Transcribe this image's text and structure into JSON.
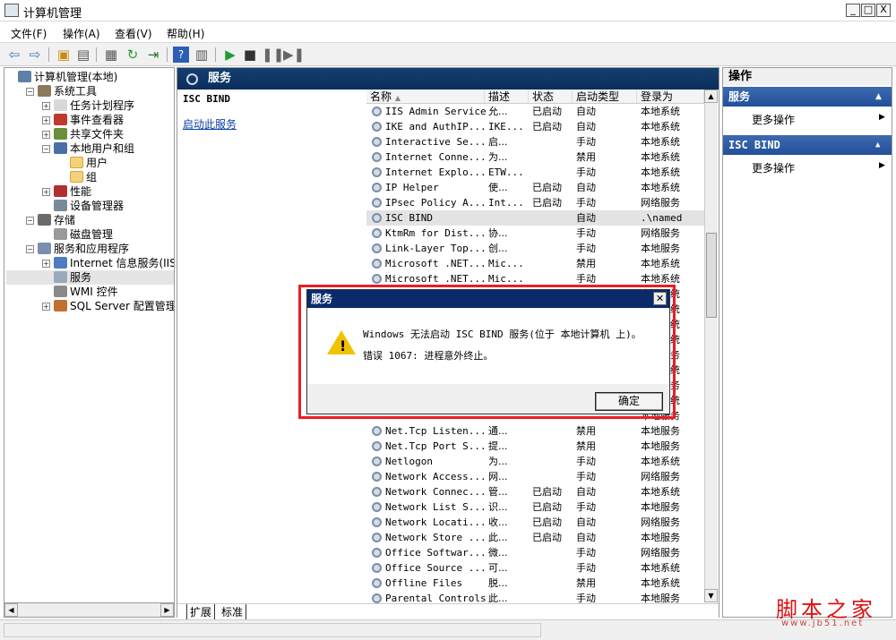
{
  "window": {
    "title": "计算机管理",
    "controls": [
      "_",
      "□",
      "X"
    ]
  },
  "menu": [
    "文件(F)",
    "操作(A)",
    "查看(V)",
    "帮助(H)"
  ],
  "toolbar": {
    "icons": [
      "back-icon",
      "forward-icon",
      "up-icon",
      "show-hide-tree-icon",
      "properties-icon",
      "refresh-icon",
      "export-icon",
      "help-icon",
      "view-icon",
      "play-icon",
      "stop-icon",
      "pause-icon",
      "resume-icon"
    ]
  },
  "tree": [
    {
      "label": "计算机管理(本地)",
      "depth": 0,
      "exp": "",
      "icon": "computer-icon"
    },
    {
      "label": "系统工具",
      "depth": 1,
      "exp": "−",
      "icon": "tools-icon"
    },
    {
      "label": "任务计划程序",
      "depth": 2,
      "exp": "+",
      "icon": "clock-icon"
    },
    {
      "label": "事件查看器",
      "depth": 2,
      "exp": "+",
      "icon": "event-icon"
    },
    {
      "label": "共享文件夹",
      "depth": 2,
      "exp": "+",
      "icon": "share-icon"
    },
    {
      "label": "本地用户和组",
      "depth": 2,
      "exp": "−",
      "icon": "users-icon"
    },
    {
      "label": "用户",
      "depth": 3,
      "exp": "",
      "icon": "folder-icon"
    },
    {
      "label": "组",
      "depth": 3,
      "exp": "",
      "icon": "folder-icon"
    },
    {
      "label": "性能",
      "depth": 2,
      "exp": "+",
      "icon": "performance-icon"
    },
    {
      "label": "设备管理器",
      "depth": 2,
      "exp": "",
      "icon": "device-icon"
    },
    {
      "label": "存储",
      "depth": 1,
      "exp": "−",
      "icon": "storage-icon"
    },
    {
      "label": "磁盘管理",
      "depth": 2,
      "exp": "",
      "icon": "disk-icon"
    },
    {
      "label": "服务和应用程序",
      "depth": 1,
      "exp": "−",
      "icon": "services-apps-icon"
    },
    {
      "label": "Internet 信息服务(IIS",
      "depth": 2,
      "exp": "+",
      "icon": "iis-icon"
    },
    {
      "label": "服务",
      "depth": 2,
      "exp": "",
      "icon": "gear-icon"
    },
    {
      "label": "WMI 控件",
      "depth": 2,
      "exp": "",
      "icon": "wmi-icon"
    },
    {
      "label": "SQL Server 配置管理器",
      "depth": 2,
      "exp": "+",
      "icon": "sql-icon"
    }
  ],
  "middle": {
    "header": "服务",
    "selected_service": "ISC BIND",
    "start_link_text": "启动此服务",
    "columns": [
      "名称",
      "描述",
      "状态",
      "启动类型",
      "登录为"
    ],
    "rows": [
      [
        "IIS Admin Service",
        "允...",
        "已启动",
        "自动",
        "本地系统"
      ],
      [
        "IKE and AuthIP...",
        "IKE...",
        "已启动",
        "自动",
        "本地系统"
      ],
      [
        "Interactive Se...",
        "启...",
        "",
        "手动",
        "本地系统"
      ],
      [
        "Internet Conne...",
        "为...",
        "",
        "禁用",
        "本地系统"
      ],
      [
        "Internet Explo...",
        "ETW...",
        "",
        "手动",
        "本地系统"
      ],
      [
        "IP Helper",
        "使...",
        "已启动",
        "自动",
        "本地系统"
      ],
      [
        "IPsec Policy A...",
        "Int...",
        "已启动",
        "手动",
        "网络服务"
      ],
      [
        "ISC BIND",
        "",
        "",
        "自动",
        ".\\named"
      ],
      [
        "KtmRm for Dist...",
        "协...",
        "",
        "手动",
        "网络服务"
      ],
      [
        "Link-Layer Top...",
        "创...",
        "",
        "手动",
        "本地服务"
      ],
      [
        "Microsoft .NET...",
        "Mic...",
        "",
        "禁用",
        "本地系统"
      ],
      [
        "Microsoft .NET...",
        "Mic...",
        "",
        "手动",
        "本地系统"
      ],
      [
        "",
        "",
        "",
        "",
        "本地系统"
      ],
      [
        "",
        "",
        "",
        "",
        "本地系统"
      ],
      [
        "",
        "",
        "",
        "",
        "本地系统"
      ],
      [
        "",
        "",
        "",
        "",
        "本地系统"
      ],
      [
        "",
        "",
        "",
        "",
        "本地服务"
      ],
      [
        "",
        "",
        "",
        "",
        "本地系统"
      ],
      [
        "",
        "",
        "",
        "",
        "网络服务"
      ],
      [
        "",
        "",
        "",
        "",
        "本地系统"
      ],
      [
        "",
        "",
        "",
        "",
        "本地服务"
      ],
      [
        "Net.Tcp Listen...",
        "通...",
        "",
        "禁用",
        "本地服务"
      ],
      [
        "Net.Tcp Port S...",
        "提...",
        "",
        "禁用",
        "本地服务"
      ],
      [
        "Netlogon",
        "为...",
        "",
        "手动",
        "本地系统"
      ],
      [
        "Network Access...",
        "网...",
        "",
        "手动",
        "网络服务"
      ],
      [
        "Network Connec...",
        "管...",
        "已启动",
        "自动",
        "本地系统"
      ],
      [
        "Network List S...",
        "识...",
        "已启动",
        "手动",
        "本地服务"
      ],
      [
        "Network Locati...",
        "收...",
        "已启动",
        "自动",
        "网络服务"
      ],
      [
        "Network Store ...",
        "此...",
        "已启动",
        "自动",
        "本地服务"
      ],
      [
        "Office Softwar...",
        "微...",
        "",
        "手动",
        "网络服务"
      ],
      [
        "Office Source ...",
        "可...",
        "",
        "手动",
        "本地系统"
      ],
      [
        "Offline Files",
        "脱...",
        "",
        "禁用",
        "本地系统"
      ],
      [
        "Parental Controls",
        "此...",
        "",
        "手动",
        "本地服务"
      ]
    ],
    "tabs": [
      "扩展",
      "标准"
    ]
  },
  "actions": {
    "header": "操作",
    "sections": [
      {
        "title": "服务",
        "item": "更多操作"
      },
      {
        "title": "ISC BIND",
        "item": "更多操作"
      }
    ]
  },
  "dialog": {
    "title": "服务",
    "line1": "Windows 无法启动 ISC BIND 服务(位于 本地计算机 上)。",
    "line2": "错误 1067: 进程意外终止。",
    "ok_label": "确定"
  },
  "watermark": {
    "text": "脚本之家",
    "url": "www.jb51.net"
  },
  "colors": {
    "highlight_frame": "#ee1c25",
    "dialog_title": "#0a2a6c"
  }
}
